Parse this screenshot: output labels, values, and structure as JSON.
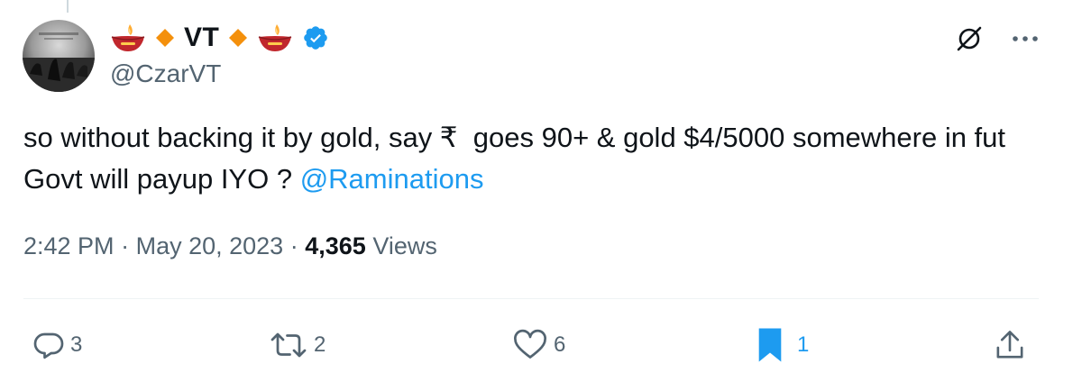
{
  "author": {
    "display_name": "VT",
    "handle": "@CzarVT",
    "verified": true,
    "name_decorations": [
      "diya-lamp-icon",
      "orange-diamond-icon",
      "orange-diamond-icon",
      "diya-lamp-icon"
    ]
  },
  "tweet": {
    "text": "so without backing it by gold, say ₹  goes 90+ & gold $4/5000 somewhere in fut Govt will payup IYO ? ",
    "mention": "@Raminations",
    "time": "2:42 PM",
    "date": "May 20, 2023",
    "separator": "·",
    "views_count": "4,365",
    "views_label": "Views"
  },
  "actions": {
    "replies": "3",
    "reposts": "2",
    "likes": "6",
    "bookmarks": "1"
  },
  "colors": {
    "accent": "#1d9bf0",
    "secondary_text": "#536471",
    "diamond": "#f4900c",
    "lamp_body": "#c1272d",
    "divider": "#eff3f4"
  }
}
